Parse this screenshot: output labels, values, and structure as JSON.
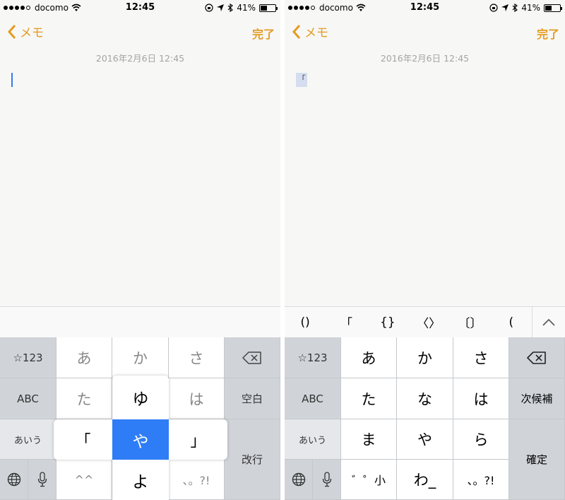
{
  "status_bar": {
    "carrier": "docomo",
    "time": "12:45",
    "battery": "41%",
    "battery_level": 0.41
  },
  "nav": {
    "back_label": "メモ",
    "done_label": "完了"
  },
  "note": {
    "date": "2016年2月6日 12:45",
    "marked_text": "「"
  },
  "left_keyboard": {
    "fn_col": [
      "☆123",
      "ABC",
      "あいう"
    ],
    "row1": [
      "あ",
      "か",
      "さ"
    ],
    "row2": [
      "た",
      "",
      "は"
    ],
    "row4": [
      "^^",
      "",
      "、。?!"
    ],
    "space_label": "空白",
    "enter_label": "改行",
    "flick": {
      "up": "ゆ",
      "left": "「",
      "center": "や",
      "right": "」",
      "down": "よ"
    }
  },
  "right_keyboard": {
    "candidates": [
      "()",
      "「",
      "{}",
      "〈〉",
      "〔〕",
      "("
    ],
    "fn_col": [
      "☆123",
      "ABC",
      "あいう"
    ],
    "row1": [
      "あ",
      "か",
      "さ"
    ],
    "row2": [
      "た",
      "な",
      "は"
    ],
    "row3": [
      "ま",
      "や",
      "ら"
    ],
    "row4": [
      "゛゜小",
      "わ_",
      "、。?!"
    ],
    "next_candidate_label": "次候補",
    "confirm_label": "確定"
  },
  "colors": {
    "accent": "#e49c22",
    "flick_blue": "#2f7df6",
    "cursor": "#3478f6"
  },
  "icons": [
    "wifi-icon",
    "orientation-lock-icon",
    "location-icon",
    "bluetooth-icon",
    "battery-icon",
    "chevron-left-icon",
    "delete-icon",
    "globe-icon",
    "mic-icon",
    "chevron-up-icon"
  ]
}
